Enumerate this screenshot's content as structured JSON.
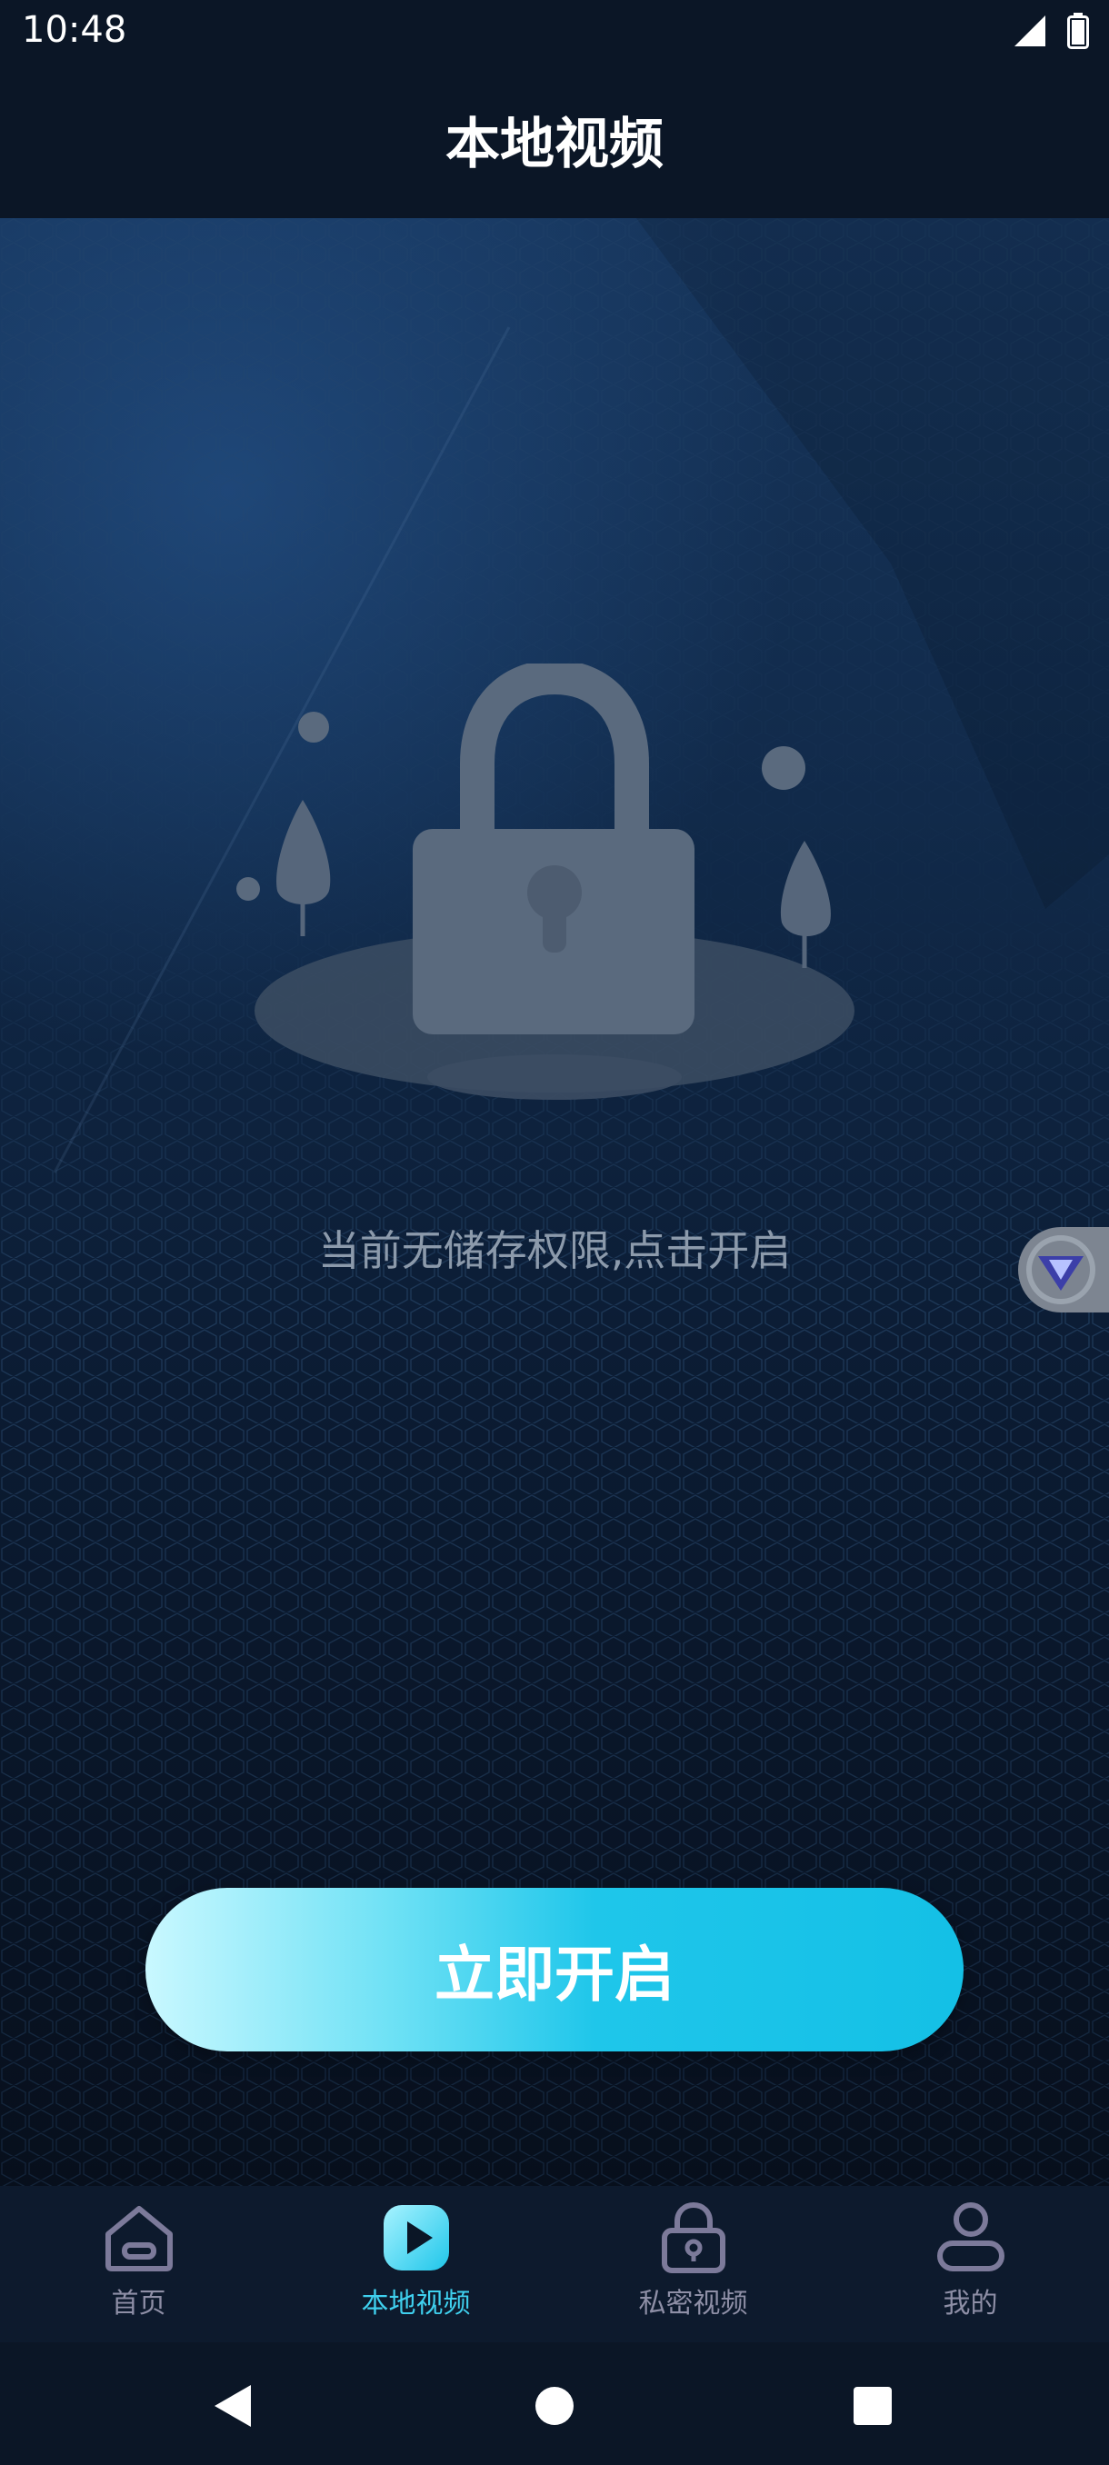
{
  "status_bar": {
    "time": "10:48",
    "signal_icon": "signal-icon",
    "battery_icon": "battery-icon"
  },
  "header": {
    "title": "本地视频"
  },
  "empty_state": {
    "illustration_icon": "lock-icon",
    "message": "当前无储存权限,点击开启",
    "action_label": "立即开启"
  },
  "floating_badge": {
    "icon": "v-logo-icon"
  },
  "tabs": [
    {
      "label": "首页",
      "icon": "home-icon",
      "active": false
    },
    {
      "label": "本地视频",
      "icon": "play-icon",
      "active": true
    },
    {
      "label": "私密视频",
      "icon": "lock-icon",
      "active": false
    },
    {
      "label": "我的",
      "icon": "user-icon",
      "active": false
    }
  ],
  "colors": {
    "accent": "#3fd0ee",
    "tab_inactive": "#8e8fa6",
    "background": "#0b1626"
  }
}
